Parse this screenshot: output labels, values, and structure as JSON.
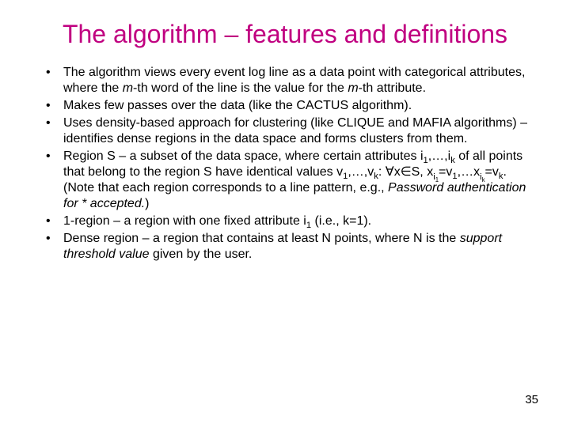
{
  "title": "The algorithm – features and definitions",
  "bullets": {
    "b1": {
      "p1": "The algorithm views every event log line as a data point with categorical attributes, where the ",
      "m1": "m",
      "p2": "-th word of the line is the value for the ",
      "m2": "m",
      "p3": "-th attribute."
    },
    "b2": "Makes few passes over the data (like the CACTUS algorithm).",
    "b3": "Uses density-based approach for clustering (like CLIQUE and MAFIA algorithms) – identifies dense regions in the data space and forms clusters from them.",
    "b4": {
      "p1": "Region S – a subset of the data space, where certain attributes i",
      "s1": "1",
      "p2": ",…,i",
      "s2": "k",
      "p3": " of all points that belong to the region S have identical values v",
      "s3": "1",
      "p4": ",…,v",
      "s4": "k",
      "p5": ": ",
      "forall": "∀",
      "p6": "x",
      "in": "∈",
      "p7": "S, x",
      "s5": "i",
      "ss5": "1",
      "p8": "=v",
      "s6": "1",
      "p9": ",…x",
      "s7": "i",
      "ss7": "k",
      "p10": "=v",
      "s8": "k",
      "p11": ". (Note that each region corresponds to a line pattern, e.g., ",
      "ex": "Password authentication for * accepted.",
      "p12": ")"
    },
    "b5": {
      "p1": "1-region – a region with one fixed attribute i",
      "s1": "1",
      "p2": " (i.e., k=1)."
    },
    "b6": {
      "p1": "Dense region – a region that contains at least N points, where N is the ",
      "em": "support threshold value",
      "p2": " given by the user."
    }
  },
  "page_number": "35"
}
